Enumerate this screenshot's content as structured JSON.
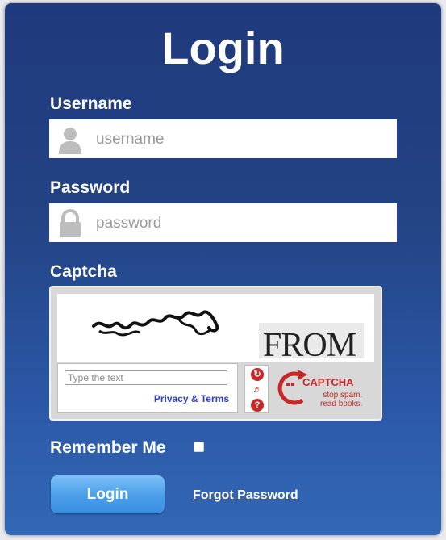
{
  "login": {
    "title": "Login",
    "username_label": "Username",
    "username_placeholder": "username",
    "password_label": "Password",
    "password_placeholder": "password",
    "captcha_label": "Captcha",
    "captcha_word": "FROM",
    "captcha_input_placeholder": "Type the text",
    "privacy_link": "Privacy & Terms",
    "captcha_brand": "CAPTCHA",
    "captcha_tagline_1": "stop spam.",
    "captcha_tagline_2": "read books.",
    "remember_label": "Remember Me",
    "remember_checked": false,
    "submit_label": "Login",
    "forgot_link": "Forgot Password"
  },
  "colors": {
    "panel_top": "#1f3a7c",
    "panel_bottom": "#3268b6",
    "button": "#4a9ee9",
    "captcha_accent": "#c62828"
  },
  "icons": {
    "username_icon": "user-icon",
    "password_icon": "lock-icon",
    "captcha_refresh": "refresh-icon",
    "captcha_audio": "audio-icon",
    "captcha_help": "help-icon"
  }
}
